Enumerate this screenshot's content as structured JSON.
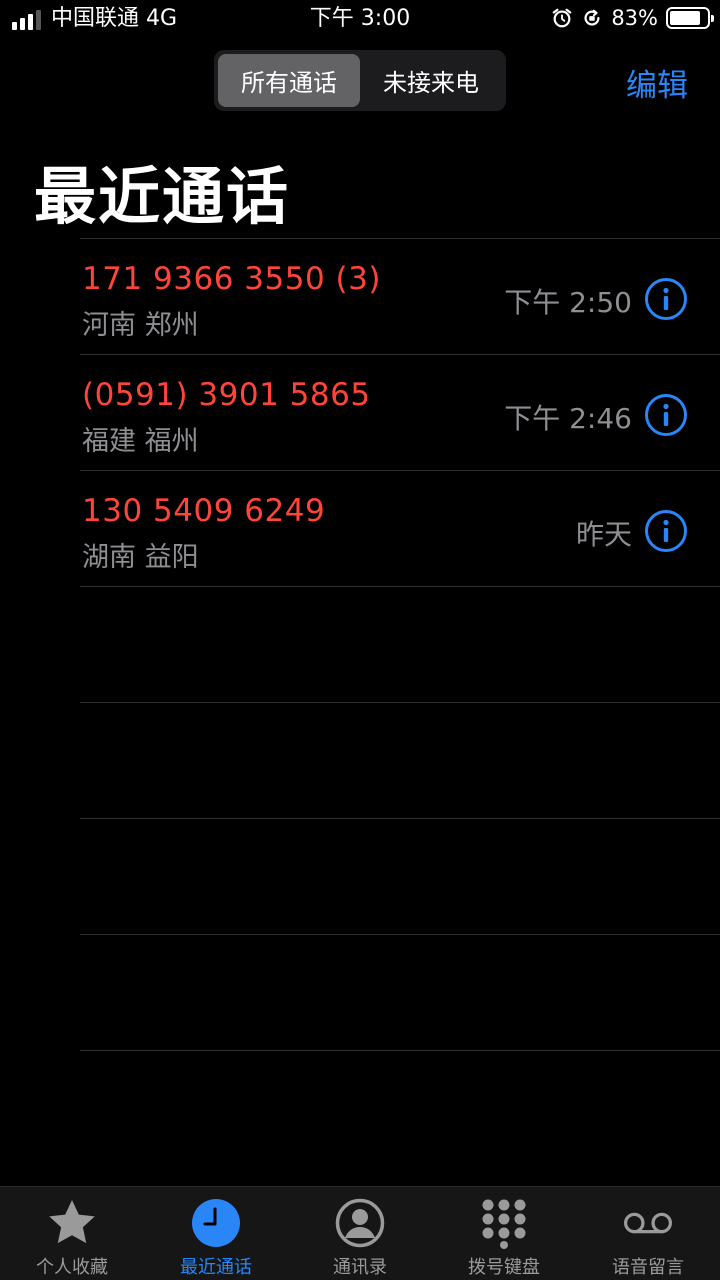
{
  "status_bar": {
    "carrier": "中国联通  4G",
    "time": "下午 3:00",
    "battery_percent": "83%",
    "battery_level": 0.83
  },
  "segmented": {
    "all_calls": "所有通话",
    "missed": "未接来电"
  },
  "edit_label": "编辑",
  "title": "最近通话",
  "calls": [
    {
      "number": "171 9366 3550 (3)",
      "location": "河南 郑州",
      "time": "下午 2:50"
    },
    {
      "number": "(0591) 3901 5865",
      "location": "福建 福州",
      "time": "下午 2:46"
    },
    {
      "number": "130 5409 6249",
      "location": "湖南 益阳",
      "time": "昨天"
    }
  ],
  "colors": {
    "accent": "#2a86f7",
    "missed_call": "#ff453a",
    "secondary_text": "#8e8e93"
  },
  "tabs": [
    {
      "label": "个人收藏",
      "icon": "star-icon"
    },
    {
      "label": "最近通话",
      "icon": "clock-icon"
    },
    {
      "label": "通讯录",
      "icon": "person-icon"
    },
    {
      "label": "拨号键盘",
      "icon": "keypad-icon"
    },
    {
      "label": "语音留言",
      "icon": "voicemail-icon"
    }
  ]
}
